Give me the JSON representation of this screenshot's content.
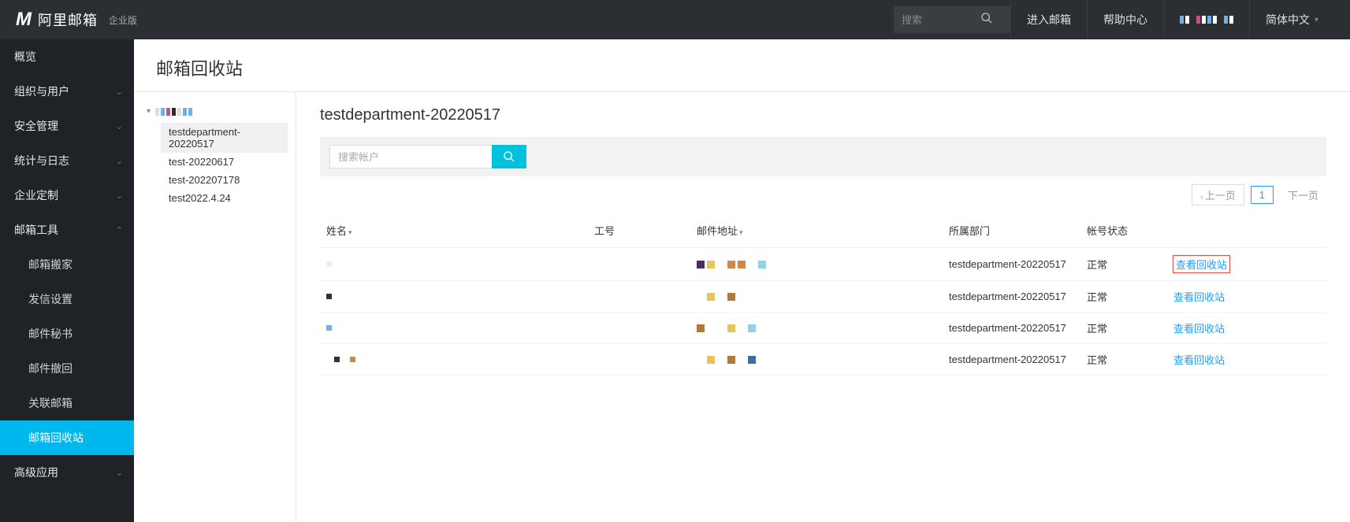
{
  "header": {
    "logo_text": "阿里邮箱",
    "logo_sub": "企业版",
    "search_placeholder": "搜索",
    "nav": {
      "enter_mail": "进入邮箱",
      "help": "帮助中心",
      "lang": "简体中文"
    }
  },
  "sidenav": {
    "overview": "概览",
    "org_users": "组织与用户",
    "security": "安全管理",
    "stats_logs": "统计与日志",
    "custom": "企业定制",
    "mail_tools": "邮箱工具",
    "tools": {
      "migrate": "邮箱搬家",
      "send_settings": "发信设置",
      "secretary": "邮件秘书",
      "recall": "邮件撤回",
      "linked": "关联邮箱",
      "recycle": "邮箱回收站"
    },
    "advanced": "高级应用"
  },
  "page": {
    "title": "邮箱回收站"
  },
  "tree": {
    "children": [
      "testdepartment-20220517",
      "test-20220617",
      "test-202207178",
      "test2022.4.24"
    ]
  },
  "panel": {
    "title": "testdepartment-20220517",
    "search_placeholder": "搜索帐户",
    "pager": {
      "prev": "上一页",
      "page": "1",
      "next": "下一页"
    },
    "columns": {
      "name": "姓名",
      "empno": "工号",
      "email": "邮件地址",
      "dept": "所属部门",
      "status": "帐号状态"
    },
    "status_ok": "正常",
    "action_label": "查看回收站",
    "rows": [
      {
        "dept": "testdepartment-20220517"
      },
      {
        "dept": "testdepartment-20220517"
      },
      {
        "dept": "testdepartment-20220517"
      },
      {
        "dept": "testdepartment-20220517"
      }
    ]
  }
}
